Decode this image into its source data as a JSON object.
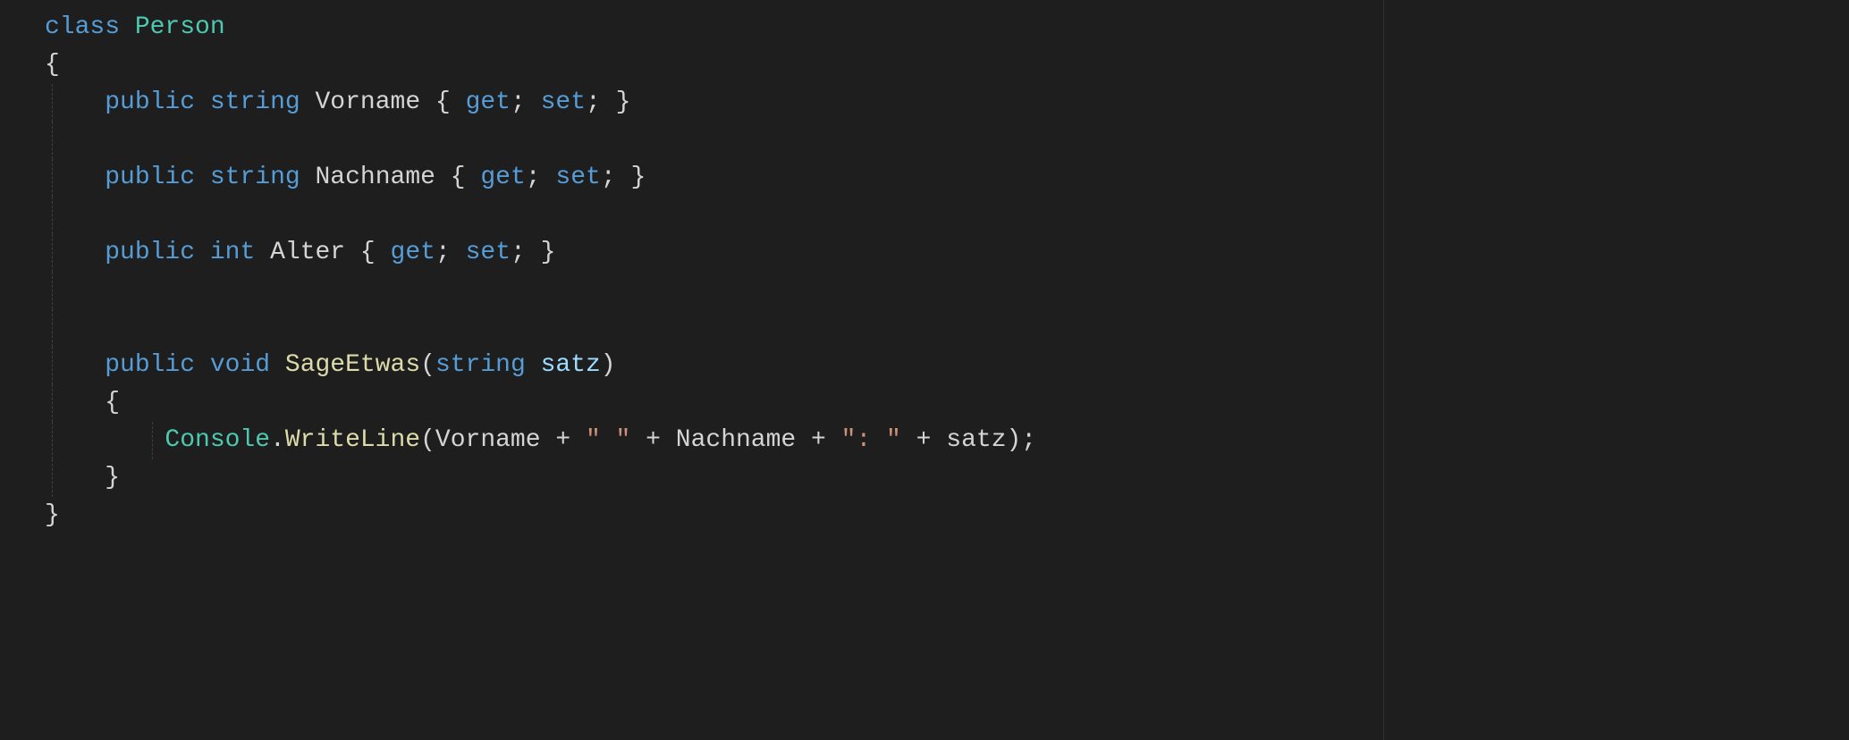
{
  "code": {
    "l1_class": "class",
    "l1_type": "Person",
    "l2_brace": "{",
    "l3_public": "public",
    "l3_string": "string",
    "l3_ident": "Vorname",
    "l3_open": "{",
    "l3_get": "get",
    "l3_semi1": ";",
    "l3_set": "set",
    "l3_semi2": ";",
    "l3_close": "}",
    "l5_public": "public",
    "l5_string": "string",
    "l5_ident": "Nachname",
    "l5_open": "{",
    "l5_get": "get",
    "l5_semi1": ";",
    "l5_set": "set",
    "l5_semi2": ";",
    "l5_close": "}",
    "l7_public": "public",
    "l7_int": "int",
    "l7_ident": "Alter",
    "l7_open": "{",
    "l7_get": "get",
    "l7_semi1": ";",
    "l7_set": "set",
    "l7_semi2": ";",
    "l7_close": "}",
    "l10_public": "public",
    "l10_void": "void",
    "l10_method": "SageEtwas",
    "l10_lpar": "(",
    "l10_string": "string",
    "l10_param": "satz",
    "l10_rpar": ")",
    "l11_brace": "{",
    "l12_console": "Console",
    "l12_dot": ".",
    "l12_write": "WriteLine",
    "l12_lpar": "(",
    "l12_vor": "Vorname",
    "l12_plus1": " + ",
    "l12_str1": "\" \"",
    "l12_plus2": " + ",
    "l12_nach": "Nachname",
    "l12_plus3": " + ",
    "l12_str2": "\": \"",
    "l12_plus4": " + ",
    "l12_satz": "satz",
    "l12_rpar_semi": ");",
    "l13_brace": "}",
    "l14_brace": "}"
  }
}
